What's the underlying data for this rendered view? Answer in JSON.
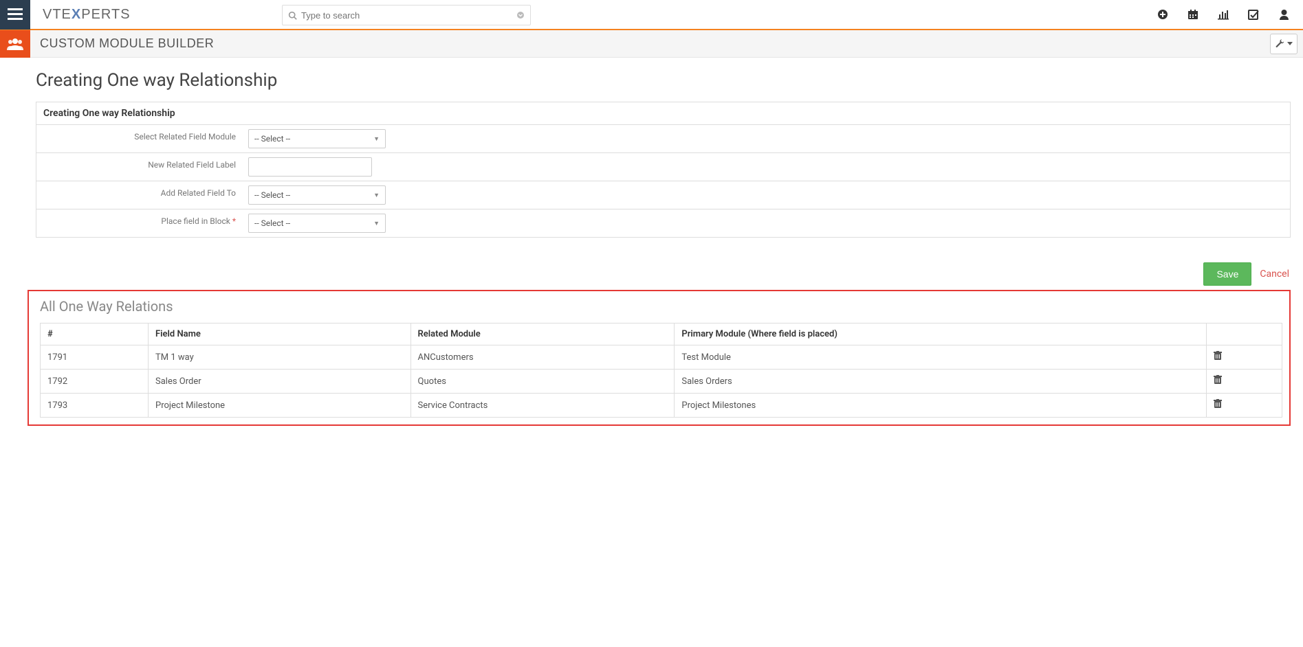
{
  "header": {
    "logo_pre": "VTE",
    "logo_x": "X",
    "logo_post": "PERTS",
    "search_placeholder": "Type to search"
  },
  "subheader": {
    "title": "CUSTOM MODULE BUILDER"
  },
  "page": {
    "title": "Creating One way Relationship",
    "panel_heading": "Creating One way Relationship"
  },
  "form": {
    "select_related_field_module": {
      "label": "Select Related Field Module",
      "value": "-- Select --"
    },
    "new_related_field_label": {
      "label": "New Related Field Label",
      "value": ""
    },
    "add_related_field_to": {
      "label": "Add Related Field To",
      "value": "-- Select --"
    },
    "place_field_in_block": {
      "label": "Place field in Block",
      "value": "-- Select --",
      "required_marker": "*"
    }
  },
  "actions": {
    "save": "Save",
    "cancel": "Cancel"
  },
  "relations": {
    "title": "All One Way Relations",
    "columns": {
      "num": "#",
      "field_name": "Field Name",
      "related_module": "Related Module",
      "primary_module": "Primary Module (Where field is placed)"
    },
    "rows": [
      {
        "num": "1791",
        "field_name": "TM 1 way",
        "related_module": "ANCustomers",
        "primary_module": "Test Module"
      },
      {
        "num": "1792",
        "field_name": "Sales Order",
        "related_module": "Quotes",
        "primary_module": "Sales Orders"
      },
      {
        "num": "1793",
        "field_name": "Project Milestone",
        "related_module": "Service Contracts",
        "primary_module": "Project Milestones"
      }
    ]
  }
}
